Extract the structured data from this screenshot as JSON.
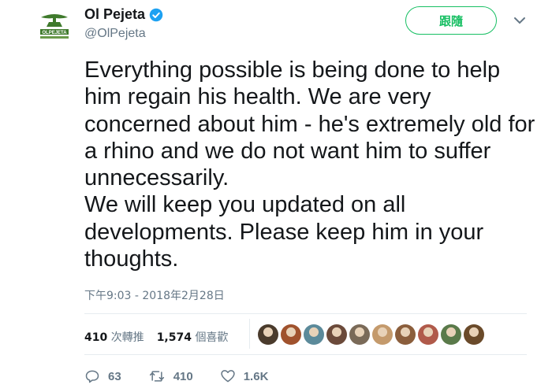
{
  "profile": {
    "display_name": "Ol Pejeta",
    "handle": "@OlPejeta",
    "verified": true,
    "avatar_text": "OLPEJETA"
  },
  "follow_button": {
    "label": "跟隨"
  },
  "tweet": {
    "text": "Everything possible is being done to help him regain his health. We are very concerned about him - he's extremely old for a rhino and we do not want him to suffer unnecessarily.\nWe will keep you updated on all developments. Please keep him in your thoughts.",
    "timestamp": "下午9:03 - 2018年2月28日"
  },
  "stats": {
    "retweets_count": "410",
    "retweets_label": "次轉推",
    "likes_count": "1,574",
    "likes_label": "個喜歡"
  },
  "liker_avatar_colors": [
    "#4a3b2c",
    "#a0522d",
    "#5b8a9a",
    "#6b4a3a",
    "#7a6a58",
    "#c49a6c",
    "#8b5e3c",
    "#b05a4a",
    "#5a7a4a",
    "#6a4a2a"
  ],
  "actions": {
    "replies": "63",
    "retweets": "410",
    "likes": "1.6K"
  },
  "colors": {
    "accent_green": "#17bf63",
    "muted": "#657786",
    "verified_blue": "#1da1f2"
  }
}
